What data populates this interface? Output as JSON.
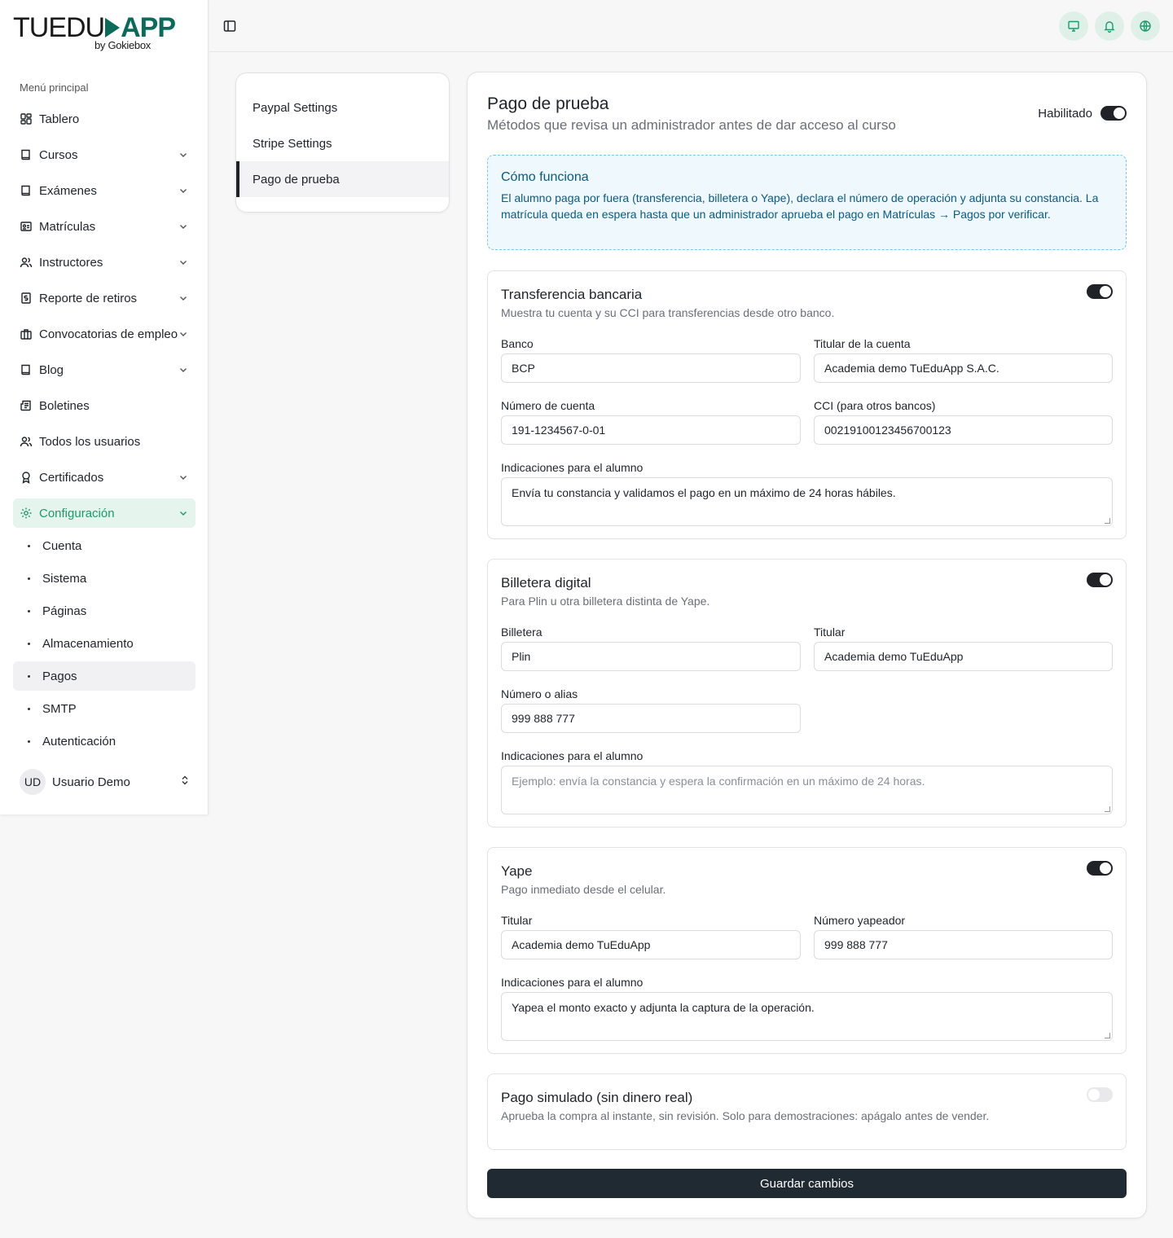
{
  "brand": {
    "logo_left": "TUEDU",
    "logo_right": "APP",
    "logo_sub": "by Gokiebox"
  },
  "sidebar": {
    "menu_label": "Menú principal",
    "items": [
      {
        "label": "Tablero",
        "icon": "dashboard-icon"
      },
      {
        "label": "Cursos",
        "icon": "book-icon"
      },
      {
        "label": "Exámenes",
        "icon": "book-icon"
      },
      {
        "label": "Matrículas",
        "icon": "id-card-icon"
      },
      {
        "label": "Instructores",
        "icon": "users-icon"
      },
      {
        "label": "Reporte de retiros",
        "icon": "money-icon"
      },
      {
        "label": "Convocatorias de empleo",
        "icon": "briefcase-icon"
      },
      {
        "label": "Blog",
        "icon": "book-icon"
      },
      {
        "label": "Boletines",
        "icon": "newspaper-icon"
      },
      {
        "label": "Todos los usuarios",
        "icon": "users-icon"
      },
      {
        "label": "Certificados",
        "icon": "award-icon"
      },
      {
        "label": "Configuración",
        "icon": "gear-icon"
      }
    ],
    "submenu": [
      "Cuenta",
      "Sistema",
      "Páginas",
      "Almacenamiento",
      "Pagos",
      "SMTP",
      "Autenticación"
    ],
    "user": {
      "initials": "UD",
      "name": "Usuario Demo"
    }
  },
  "settings_nav": [
    "Paypal Settings",
    "Stripe Settings",
    "Pago de prueba"
  ],
  "main": {
    "title": "Pago de prueba",
    "subtitle": "Métodos que revisa un administrador antes de dar acceso al curso",
    "enabled_label": "Habilitado",
    "info_title": "Cómo funciona",
    "info_text": "El alumno paga por fuera (transferencia, billetera o Yape), declara el número de operación y adjunta su constancia. La matrícula queda en espera hasta que un administrador aprueba el pago en Matrículas → Pagos por verificar.",
    "bank": {
      "title": "Transferencia bancaria",
      "subtitle": "Muestra tu cuenta y su CCI para transferencias desde otro banco.",
      "bank_label": "Banco",
      "bank_value": "BCP",
      "holder_label": "Titular de la cuenta",
      "holder_value": "Academia demo TuEduApp S.A.C.",
      "account_label": "Número de cuenta",
      "account_value": "191-1234567-0-01",
      "cci_label": "CCI (para otros bancos)",
      "cci_value": "00219100123456700123",
      "notes_label": "Indicaciones para el alumno",
      "notes_value": "Envía tu constancia y validamos el pago en un máximo de 24 horas hábiles."
    },
    "wallet": {
      "title": "Billetera digital",
      "subtitle": "Para Plin u otra billetera distinta de Yape.",
      "wallet_label": "Billetera",
      "wallet_value": "Plin",
      "holder_label": "Titular",
      "holder_value": "Academia demo TuEduApp",
      "number_label": "Número o alias",
      "number_value": "999 888 777",
      "notes_label": "Indicaciones para el alumno",
      "notes_placeholder": "Ejemplo: envía la constancia y espera la confirmación en un máximo de 24 horas."
    },
    "yape": {
      "title": "Yape",
      "subtitle": "Pago inmediato desde el celular.",
      "holder_label": "Titular",
      "holder_value": "Academia demo TuEduApp",
      "number_label": "Número yapeador",
      "number_value": "999 888 777",
      "notes_label": "Indicaciones para el alumno",
      "notes_value": "Yapea el monto exacto y adjunta la captura de la operación."
    },
    "simulated": {
      "title": "Pago simulado (sin dinero real)",
      "subtitle": "Aprueba la compra al instante, sin revisión. Solo para demostraciones: apágalo antes de vender."
    },
    "save_label": "Guardar cambios"
  },
  "colors": {
    "accent": "#0b6b5a",
    "active_menu_bg": "#e6f4ee",
    "active_menu_text": "#1a9a6c",
    "info_bg": "#eef8fd",
    "info_text": "#0a5a86",
    "primary_button": "#1f2a33"
  }
}
